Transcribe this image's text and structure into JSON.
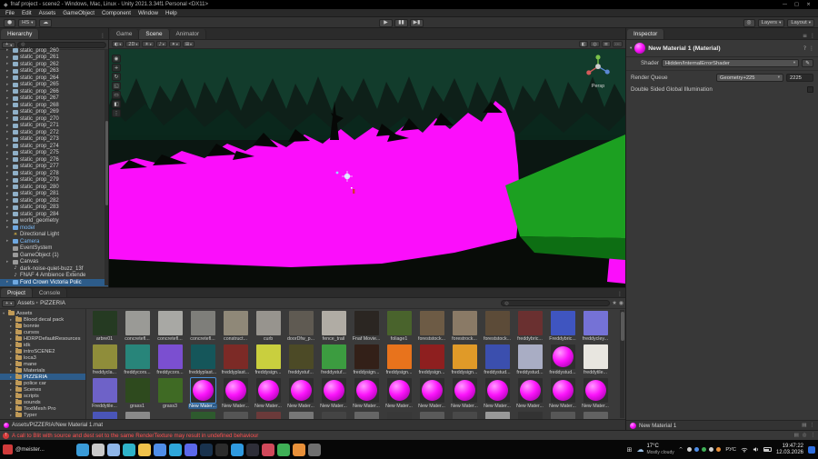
{
  "title_bar": {
    "title": "fnaf project - scene2 - Windows, Mac, Linux - Unity 2021.3.34f1 Personal <DX11>",
    "minimize": "—",
    "maximize": "▢",
    "close": "×"
  },
  "menu_bar": {
    "items": [
      "File",
      "Edit",
      "Assets",
      "GameObject",
      "Component",
      "Window",
      "Help"
    ]
  },
  "toolbar": {
    "account_initials": "HS",
    "play": "▶",
    "pause": "▮▮",
    "step": "▶▮",
    "layers_label": "Layers",
    "layout_label": "Layout"
  },
  "hierarchy": {
    "tab_label": "Hierarchy",
    "items": [
      {
        "arrow": "▸",
        "glyph": "",
        "label": "static_prop_260",
        "type": "prop"
      },
      {
        "arrow": "▸",
        "glyph": "",
        "label": "static_prop_261",
        "type": "prop"
      },
      {
        "arrow": "▸",
        "glyph": "",
        "label": "static_prop_262",
        "type": "prop"
      },
      {
        "arrow": "▸",
        "glyph": "",
        "label": "static_prop_263",
        "type": "prop"
      },
      {
        "arrow": "▸",
        "glyph": "",
        "label": "static_prop_264",
        "type": "prop"
      },
      {
        "arrow": "▸",
        "glyph": "",
        "label": "static_prop_265",
        "type": "prop"
      },
      {
        "arrow": "▸",
        "glyph": "",
        "label": "static_prop_266",
        "type": "prop"
      },
      {
        "arrow": "▸",
        "glyph": "",
        "label": "static_prop_267",
        "type": "prop"
      },
      {
        "arrow": "▸",
        "glyph": "",
        "label": "static_prop_268",
        "type": "prop"
      },
      {
        "arrow": "▸",
        "glyph": "",
        "label": "static_prop_269",
        "type": "prop"
      },
      {
        "arrow": "▸",
        "glyph": "",
        "label": "static_prop_270",
        "type": "prop"
      },
      {
        "arrow": "▸",
        "glyph": "",
        "label": "static_prop_271",
        "type": "prop"
      },
      {
        "arrow": "▸",
        "glyph": "",
        "label": "static_prop_272",
        "type": "prop"
      },
      {
        "arrow": "▸",
        "glyph": "",
        "label": "static_prop_273",
        "type": "prop"
      },
      {
        "arrow": "▸",
        "glyph": "",
        "label": "static_prop_274",
        "type": "prop"
      },
      {
        "arrow": "▸",
        "glyph": "",
        "label": "static_prop_275",
        "type": "prop"
      },
      {
        "arrow": "▸",
        "glyph": "",
        "label": "static_prop_276",
        "type": "prop"
      },
      {
        "arrow": "▸",
        "glyph": "",
        "label": "static_prop_277",
        "type": "prop"
      },
      {
        "arrow": "▸",
        "glyph": "",
        "label": "static_prop_278",
        "type": "prop"
      },
      {
        "arrow": "▸",
        "glyph": "",
        "label": "static_prop_279",
        "type": "prop"
      },
      {
        "arrow": "▸",
        "glyph": "",
        "label": "static_prop_280",
        "type": "prop"
      },
      {
        "arrow": "▸",
        "glyph": "",
        "label": "static_prop_281",
        "type": "prop"
      },
      {
        "arrow": "▸",
        "glyph": "",
        "label": "static_prop_282",
        "type": "prop"
      },
      {
        "arrow": "▸",
        "glyph": "",
        "label": "static_prop_283",
        "type": "prop"
      },
      {
        "arrow": "▸",
        "glyph": "",
        "label": "static_prop_284",
        "type": "prop"
      },
      {
        "arrow": "▸",
        "glyph": "",
        "label": "world_geometry",
        "type": "prop"
      },
      {
        "arrow": "▸",
        "glyph": "",
        "label": "model",
        "type": "prefab"
      },
      {
        "arrow": "",
        "glyph": "☀",
        "label": "Directional Light",
        "type": "light",
        "cls": "gl"
      },
      {
        "arrow": "▸",
        "glyph": "",
        "label": "Camera",
        "type": "prefab"
      },
      {
        "arrow": "",
        "glyph": "",
        "label": "EventSystem",
        "type": "obj"
      },
      {
        "arrow": "",
        "glyph": "",
        "label": "GameObject (1)",
        "type": "obj"
      },
      {
        "arrow": "▸",
        "glyph": "",
        "label": "Canvas",
        "type": "obj"
      },
      {
        "arrow": "",
        "glyph": "♪",
        "label": "dark-noise-quiet-buzz_13f",
        "type": "audio",
        "cls": "gl"
      },
      {
        "arrow": "",
        "glyph": "♪",
        "label": "FNAF 4 Ambience Extende",
        "type": "audio",
        "cls": "gl"
      },
      {
        "arrow": "▸",
        "glyph": "",
        "label": "Ford Crown Victoria Polic",
        "type": "prefab",
        "selected": true
      }
    ]
  },
  "scene": {
    "tabs": [
      {
        "label": "Game"
      },
      {
        "label": "Scene",
        "selected": true
      },
      {
        "label": "Animator"
      }
    ],
    "controls_left": [
      {
        "name": "shading-mode-dropdown",
        "glyph": "◐"
      },
      {
        "name": "2d-toggle",
        "glyph": "2D"
      },
      {
        "name": "lighting-toggle",
        "glyph": "☀"
      },
      {
        "name": "audio-toggle",
        "glyph": "♪"
      },
      {
        "name": "effects-dropdown",
        "glyph": "✦"
      },
      {
        "name": "grid-dropdown",
        "glyph": "⊞"
      }
    ],
    "controls_right": [
      {
        "name": "tool-settings",
        "glyph": "◧"
      },
      {
        "name": "scene-search",
        "glyph": "◎"
      },
      {
        "name": "gizmos-dropdown",
        "glyph": "≡"
      },
      {
        "name": "more-options",
        "glyph": "⋯"
      }
    ],
    "tools": [
      {
        "name": "view-tool",
        "glyph": "◉"
      },
      {
        "name": "move-tool",
        "glyph": "+"
      },
      {
        "name": "rotate-tool",
        "glyph": "↻"
      },
      {
        "name": "scale-tool",
        "glyph": "◱"
      },
      {
        "name": "rect-tool",
        "glyph": "▭"
      },
      {
        "name": "transform-tool",
        "glyph": "◧"
      },
      {
        "name": "custom-tool",
        "glyph": "⋮"
      }
    ],
    "gizmo_label": "Persp"
  },
  "inspector": {
    "tab_label": "Inspector",
    "title": "New Material 1 (Material)",
    "shader_label": "Shader",
    "shader_value": "Hidden/InternalErrorShader",
    "render_queue_label": "Render Queue",
    "render_queue_value": "Geometry+225",
    "render_queue_number": "2225",
    "dsgi_label": "Double Sided Global Illumination",
    "footer_label": "New Material 1"
  },
  "project": {
    "tab_label": "Project",
    "console_label": "Console",
    "breadcrumb": {
      "root": "Assets",
      "sep": "▸",
      "current": "PIZZERIA"
    },
    "path": "Assets/PIZZERIA/New Material 1.mat",
    "folders": [
      {
        "arrow": "▾",
        "label": "Assets",
        "root": true
      },
      {
        "arrow": "▸",
        "label": "Blood decal pack"
      },
      {
        "arrow": "▸",
        "label": "bonnie"
      },
      {
        "arrow": "▸",
        "label": "cursos"
      },
      {
        "arrow": "▸",
        "label": "HDRPDefaultResources"
      },
      {
        "arrow": "▸",
        "label": "idk"
      },
      {
        "arrow": "▸",
        "label": "introSCENE2"
      },
      {
        "arrow": "▸",
        "label": "loca3"
      },
      {
        "arrow": "▸",
        "label": "mane"
      },
      {
        "arrow": "▸",
        "label": "Materials"
      },
      {
        "arrow": "▸",
        "label": "PIZZERIA",
        "selected": true
      },
      {
        "arrow": "▸",
        "label": "police car"
      },
      {
        "arrow": "▸",
        "label": "Scenes"
      },
      {
        "arrow": "▸",
        "label": "scripts"
      },
      {
        "arrow": "▸",
        "label": "sounds"
      },
      {
        "arrow": "▸",
        "label": "TextMesh Pro"
      },
      {
        "arrow": "▸",
        "label": "Typer"
      }
    ],
    "assets": [
      {
        "label": "arbre01",
        "kind": "tex",
        "color": "#253a22"
      },
      {
        "label": "concretefl...",
        "kind": "tex",
        "color": "#9a9a96"
      },
      {
        "label": "concretefl...",
        "kind": "tex",
        "color": "#a8a8a4"
      },
      {
        "label": "concretefl...",
        "kind": "tex",
        "color": "#7e7e7a"
      },
      {
        "label": "construct...",
        "kind": "tex",
        "color": "#8f8878"
      },
      {
        "label": "curb",
        "kind": "tex",
        "color": "#97948e"
      },
      {
        "label": "doorDfw_p...",
        "kind": "tex",
        "color": "#5f5a52"
      },
      {
        "label": "fence_trail",
        "kind": "tex",
        "color": "#b0aca4"
      },
      {
        "label": "Fnaf Movie...",
        "kind": "tex",
        "color": "#2b2622"
      },
      {
        "label": "foliage1",
        "kind": "tex",
        "color": "#49632c"
      },
      {
        "label": "foreststock...",
        "kind": "tex",
        "color": "#6d5b45"
      },
      {
        "label": "forestrock...",
        "kind": "tex",
        "color": "#8a7a66"
      },
      {
        "label": "foreststock...",
        "kind": "tex",
        "color": "#5c4b38"
      },
      {
        "label": "freddybric...",
        "kind": "tex",
        "color": "#6a3030"
      },
      {
        "label": "Freddybric...",
        "kind": "tex",
        "color": "#3f55c0"
      },
      {
        "label": "freddycley...",
        "kind": "tex",
        "color": "#7572d6"
      },
      {
        "label": "freddycla...",
        "kind": "tex",
        "color": "#8f8d3a"
      },
      {
        "label": "freddycors...",
        "kind": "tex",
        "color": "#28857a"
      },
      {
        "label": "freddycors...",
        "kind": "tex",
        "color": "#7b4fd0"
      },
      {
        "label": "freddyplast...",
        "kind": "tex",
        "color": "#15565a"
      },
      {
        "label": "freddyplast...",
        "kind": "tex",
        "color": "#7c2a26"
      },
      {
        "label": "freddysign...",
        "kind": "tex",
        "color": "#c9cf3e"
      },
      {
        "label": "freddystuf...",
        "kind": "tex",
        "color": "#4c4a26"
      },
      {
        "label": "freddystuf...",
        "kind": "tex",
        "color": "#3c9c40"
      },
      {
        "label": "freddysign...",
        "kind": "tex",
        "color": "#332018"
      },
      {
        "label": "freddysign...",
        "kind": "tex",
        "color": "#e8731c"
      },
      {
        "label": "freddysign...",
        "kind": "tex",
        "color": "#8e1f1f"
      },
      {
        "label": "freddysign...",
        "kind": "tex",
        "color": "#e09a28"
      },
      {
        "label": "freddystud...",
        "kind": "tex",
        "color": "#3b4fae"
      },
      {
        "label": "freddystud...",
        "kind": "tex",
        "color": "#a9adc4"
      },
      {
        "label": "freddystud...",
        "kind": "mat"
      },
      {
        "label": "freddytile...",
        "kind": "tex",
        "color": "#e8e6e0"
      },
      {
        "label": "Freddytile...",
        "kind": "tex",
        "color": "#6e62c8"
      },
      {
        "label": "grass1",
        "kind": "tex",
        "color": "#2e4a1e"
      },
      {
        "label": "grass3",
        "kind": "tex",
        "color": "#3f6a24"
      },
      {
        "label": "New Mater...",
        "kind": "mat",
        "selected": true
      },
      {
        "label": "New Mater...",
        "kind": "mat"
      },
      {
        "label": "New Mater...",
        "kind": "mat"
      },
      {
        "label": "New Mater...",
        "kind": "mat"
      },
      {
        "label": "New Mater...",
        "kind": "mat"
      },
      {
        "label": "New Mater...",
        "kind": "mat"
      },
      {
        "label": "New Mater...",
        "kind": "mat"
      },
      {
        "label": "New Mater...",
        "kind": "mat"
      },
      {
        "label": "New Mater...",
        "kind": "mat"
      },
      {
        "label": "New Mater...",
        "kind": "mat"
      },
      {
        "label": "New Mater...",
        "kind": "mat"
      },
      {
        "label": "New Mater...",
        "kind": "mat"
      },
      {
        "label": "New Mater...",
        "kind": "mat"
      },
      {
        "label": "",
        "kind": "tex",
        "color": "#4a55b8"
      },
      {
        "label": "",
        "kind": "tex",
        "color": "#8a8a8a"
      },
      {
        "label": "",
        "kind": "tex",
        "color": "#3a3a3a"
      },
      {
        "label": "",
        "kind": "tex",
        "color": "#2e5a2e"
      },
      {
        "label": "",
        "kind": "tex",
        "color": "#555555"
      },
      {
        "label": "",
        "kind": "tex",
        "color": "#6b3a3a"
      },
      {
        "label": "",
        "kind": "tex",
        "color": "#777777"
      },
      {
        "label": "",
        "kind": "tex",
        "color": "#444444"
      },
      {
        "label": "",
        "kind": "tex",
        "color": "#666666"
      },
      {
        "label": "",
        "kind": "tex",
        "color": "#383838"
      },
      {
        "label": "",
        "kind": "tex",
        "color": "#5a5a5a"
      },
      {
        "label": "",
        "kind": "tex",
        "color": "#494949"
      },
      {
        "label": "",
        "kind": "tex",
        "color": "#999999"
      },
      {
        "label": "",
        "kind": "tex",
        "color": "#333333"
      },
      {
        "label": "",
        "kind": "tex",
        "color": "#575757"
      },
      {
        "label": "",
        "kind": "tex",
        "color": "#626262"
      }
    ]
  },
  "status": {
    "message": "A call to Blit with source and dest set to the same RenderTexture may result in undefined behaviour"
  },
  "taskbar": {
    "left_app": "@meister...",
    "apps": [
      {
        "name": "start-button",
        "color": "#3a9bd8"
      },
      {
        "name": "search-button",
        "color": "#c9c9c9"
      },
      {
        "name": "task-view-button",
        "color": "#8fb6e8"
      },
      {
        "name": "edge-icon",
        "color": "#2fb3c9"
      },
      {
        "name": "file-explorer-icon",
        "color": "#f0c24b"
      },
      {
        "name": "browser-icon",
        "color": "#4f8ee8"
      },
      {
        "name": "telegram-icon",
        "color": "#2ea6da"
      },
      {
        "name": "discord-icon",
        "color": "#5b68ea"
      },
      {
        "name": "steam-icon",
        "color": "#19324d"
      },
      {
        "name": "unity-icon",
        "color": "#2c2c2c"
      },
      {
        "name": "vscode-icon",
        "color": "#2f9ae0"
      },
      {
        "name": "obs-icon",
        "color": "#2e2e38"
      },
      {
        "name": "photos-icon",
        "color": "#d1495b"
      },
      {
        "name": "green-app-icon",
        "color": "#3faf56"
      },
      {
        "name": "orange-app-icon",
        "color": "#e8903a"
      },
      {
        "name": "gray-app-icon",
        "color": "#6f6f6f"
      }
    ],
    "tray": [
      {
        "name": "tray-icon-1",
        "color": "#cfcfcf"
      },
      {
        "name": "tray-icon-2",
        "color": "#4f8ee8"
      },
      {
        "name": "tray-icon-3",
        "color": "#3faf56"
      },
      {
        "name": "tray-icon-4",
        "color": "#cfcfcf"
      },
      {
        "name": "tray-icon-5",
        "color": "#e8903a"
      }
    ],
    "weather": {
      "temp": "17°C",
      "desc": "Mostly cloudy"
    },
    "lang": "РУС",
    "time": "19:47:22",
    "date": "12.03.2026"
  }
}
